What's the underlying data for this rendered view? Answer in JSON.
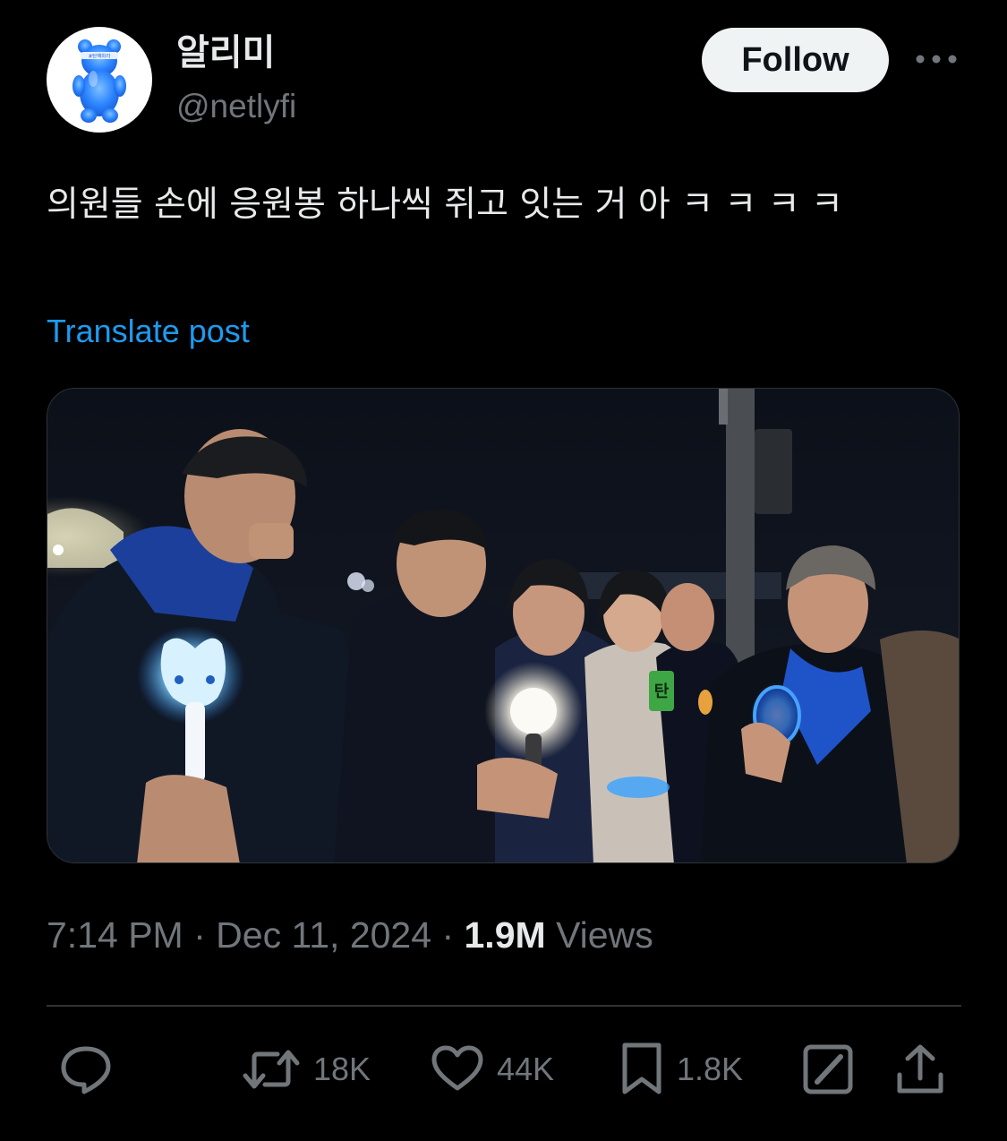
{
  "author": {
    "display_name": "알리미",
    "handle": "@netlyfi",
    "avatar_icon": "blue-gummy-bear-icon",
    "avatar_band_text": "#탄핵하라"
  },
  "header": {
    "follow_label": "Follow",
    "more_icon": "more-icon"
  },
  "tweet": {
    "text": "의원들 손에 응원봉 하나씩 쥐고 잇는 거 아 ㅋ ㅋ ㅋ ㅋ",
    "translate_label": "Translate post",
    "media": {
      "sign_text": "탄"
    }
  },
  "meta": {
    "time": "7:14 PM",
    "separator": "·",
    "date": "Dec 11, 2024",
    "views_count": "1.9M",
    "views_label": "Views"
  },
  "actions": {
    "reply": {
      "icon": "reply-icon"
    },
    "retweet": {
      "icon": "retweet-icon",
      "count": "18K"
    },
    "like": {
      "icon": "heart-icon",
      "count": "44K"
    },
    "bookmark": {
      "icon": "bookmark-icon",
      "count": "1.8K"
    },
    "grok": {
      "icon": "grok-icon"
    },
    "share": {
      "icon": "share-icon"
    }
  },
  "colors": {
    "background": "#000000",
    "text": "#e7e9ea",
    "secondary": "#71767b",
    "link": "#1d9bf0",
    "divider": "#2f3336",
    "follow_bg": "#eff3f4"
  }
}
